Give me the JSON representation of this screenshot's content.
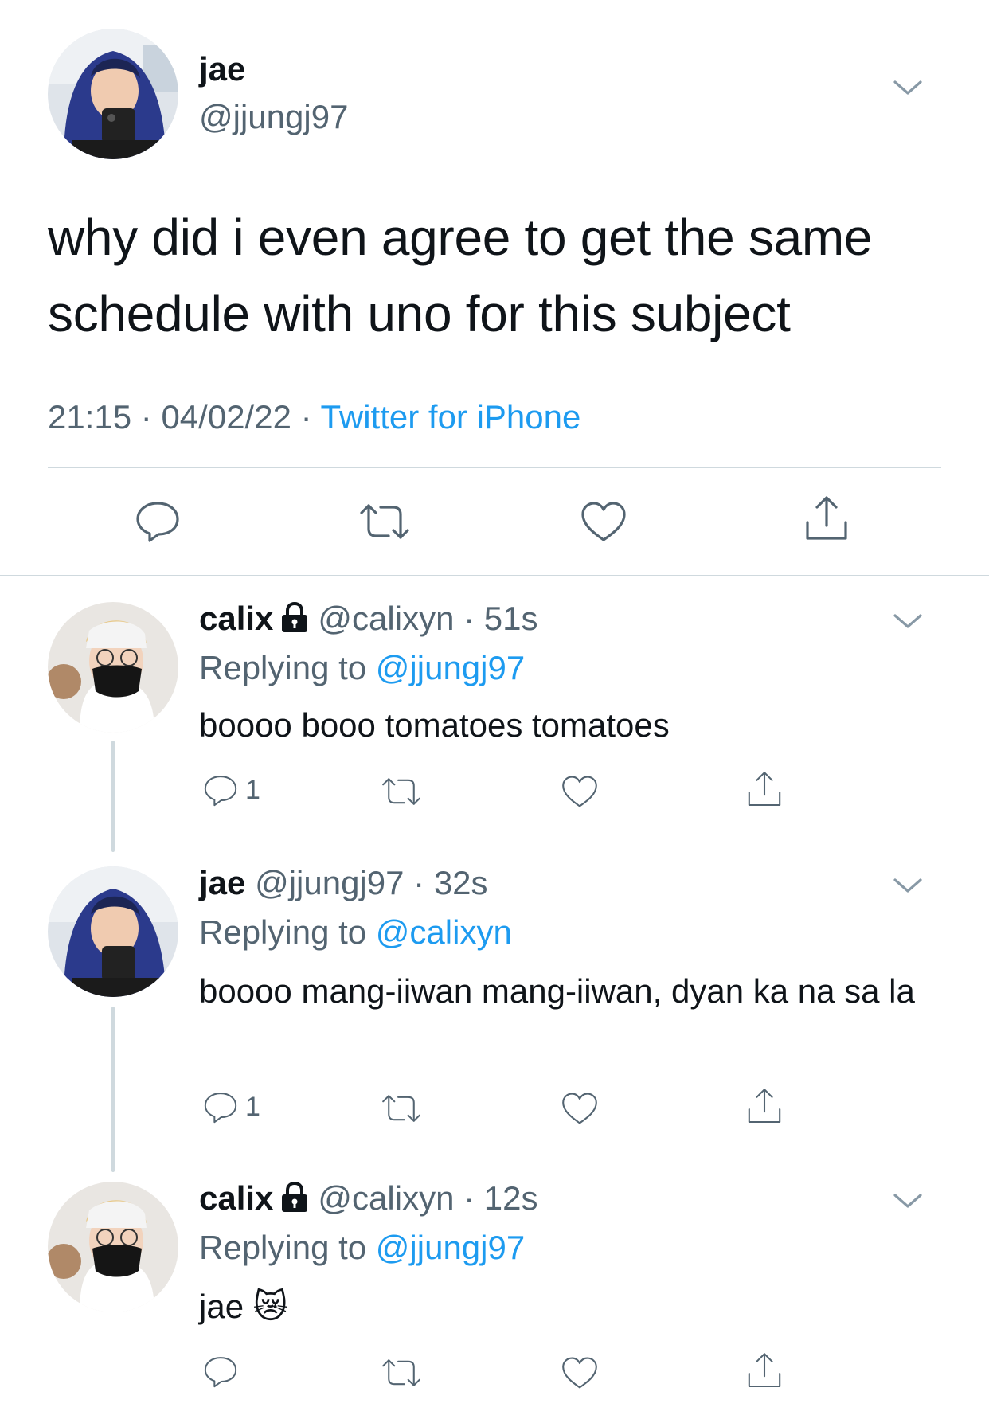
{
  "main_tweet": {
    "author_name": "jae",
    "author_handle": "@jjungj97",
    "text": "why did i even agree to get the same schedule with uno for this subject",
    "time": "21:15",
    "date": "04/02/22",
    "separator": "·",
    "source": "Twitter for iPhone"
  },
  "replies": [
    {
      "name": "calix",
      "handle": "@calixyn",
      "age": "51s",
      "replying_prefix": "Replying to",
      "replying_to": "@jjungj97",
      "text": "boooo booo tomatoes tomatoes",
      "reply_count": "1",
      "protected": true
    },
    {
      "name": "jae",
      "handle": "@jjungj97",
      "age": "32s",
      "replying_prefix": "Replying to",
      "replying_to": "@calixyn",
      "text": "boooo mang-iiwan mang-iiwan, dyan ka na sa la",
      "reply_count": "1",
      "protected": false
    },
    {
      "name": "calix",
      "handle": "@calixyn",
      "age": "12s",
      "replying_prefix": "Replying to",
      "replying_to": "@jjungj97",
      "text": "jae 😿",
      "reply_count": "",
      "protected": true
    }
  ],
  "colors": {
    "link": "#1d9bf0",
    "muted": "#536471",
    "divider": "#cfd9de",
    "text": "#0f1419"
  },
  "icons": [
    "chevron-down-icon",
    "reply-icon",
    "retweet-icon",
    "like-icon",
    "share-icon",
    "lock-icon"
  ]
}
